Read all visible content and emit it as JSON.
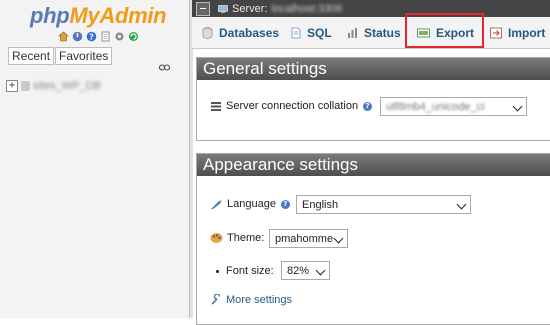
{
  "nav": {
    "logo_part1": "php",
    "logo_part2": "MyAdmin",
    "tabs": [
      "Recent",
      "Favorites"
    ],
    "db_expand_symbol": "+",
    "db_name": "sites_WP_DB"
  },
  "breadcrumb": {
    "label": "Server:",
    "value": "localhost:3306"
  },
  "tabs": [
    {
      "label": "Databases",
      "icon": "database-icon"
    },
    {
      "label": "SQL",
      "icon": "sql-icon"
    },
    {
      "label": "Status",
      "icon": "status-icon"
    },
    {
      "label": "Export",
      "icon": "export-icon",
      "highlighted": true
    },
    {
      "label": "Import",
      "icon": "import-icon"
    }
  ],
  "general": {
    "title": "General settings",
    "collation_label": "Server connection collation",
    "collation_value": "utf8mb4_unicode_ci"
  },
  "appearance": {
    "title": "Appearance settings",
    "language_label": "Language",
    "language_value": "English",
    "theme_label": "Theme:",
    "theme_value": "pmahomme",
    "fontsize_label": "Font size:",
    "fontsize_value": "82%",
    "more_settings": "More settings"
  },
  "colors": {
    "highlight_border": "#e0282e",
    "link": "#235a81",
    "panel_header": "#5a5a5a"
  }
}
